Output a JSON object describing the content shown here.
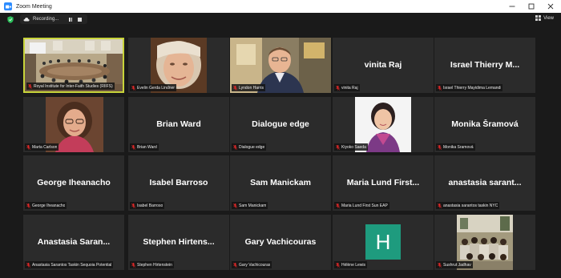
{
  "window": {
    "title": "Zoom Meeting"
  },
  "toolbar": {
    "recording_label": "Recording...",
    "view_label": "View"
  },
  "colors": {
    "accent": "#2d8cff",
    "active_speaker": "#c8d43a",
    "tile_bg": "#2b2b2b",
    "avatar_h": "#1e9b7e",
    "muted_mic": "#e02828",
    "shield": "#2cbf5b"
  },
  "participants": [
    {
      "name": "Royal Institute for Inter-Faith Studies (RIIFS)",
      "display": "",
      "kind": "video-room"
    },
    {
      "name": "Evelin Gerda Lindner",
      "display": "",
      "kind": "video-face"
    },
    {
      "name": "Lyndon Harris",
      "display": "",
      "kind": "video-man"
    },
    {
      "name": "vinita Raj",
      "display": "vinita Raj",
      "kind": "name"
    },
    {
      "name": "Israel Thierry Mayidima Lemandi",
      "display": "Israel Thierry M...",
      "kind": "name"
    },
    {
      "name": "Marta Carlson",
      "display": "",
      "kind": "video-woman"
    },
    {
      "name": "Brian Ward",
      "display": "Brian Ward",
      "kind": "name"
    },
    {
      "name": "Dialogue edge",
      "display": "Dialogue edge",
      "kind": "name"
    },
    {
      "name": "Kiyoko Saeda",
      "display": "",
      "kind": "video-kiyoko"
    },
    {
      "name": "Monika Šramová",
      "display": "Monika Šramová",
      "kind": "name"
    },
    {
      "name": "George Iheanacho",
      "display": "George Iheanacho",
      "kind": "name"
    },
    {
      "name": "Isabel Barroso",
      "display": "Isabel Barroso",
      "kind": "name"
    },
    {
      "name": "Sam Manickam",
      "display": "Sam Manickam",
      "kind": "name"
    },
    {
      "name": "Maria Lund First Sun EAP",
      "display": "Maria Lund First...",
      "kind": "name"
    },
    {
      "name": "anastasia sarantos taskin  NYC",
      "display": "anastasia sarant...",
      "kind": "name"
    },
    {
      "name": "Anastasia Sarantos Taskin  Sequoia Potential",
      "display": "Anastasia Saran...",
      "kind": "name"
    },
    {
      "name": "Stephen Hirtenstein",
      "display": "Stephen Hirtens...",
      "kind": "name"
    },
    {
      "name": "Gary Vachicouras",
      "display": "Gary Vachicouras",
      "kind": "name"
    },
    {
      "name": "Hélène Lewis",
      "display": "",
      "kind": "avatar",
      "initial": "H"
    },
    {
      "name": "Sushrut Jadhav",
      "display": "",
      "kind": "video-crowd"
    }
  ]
}
